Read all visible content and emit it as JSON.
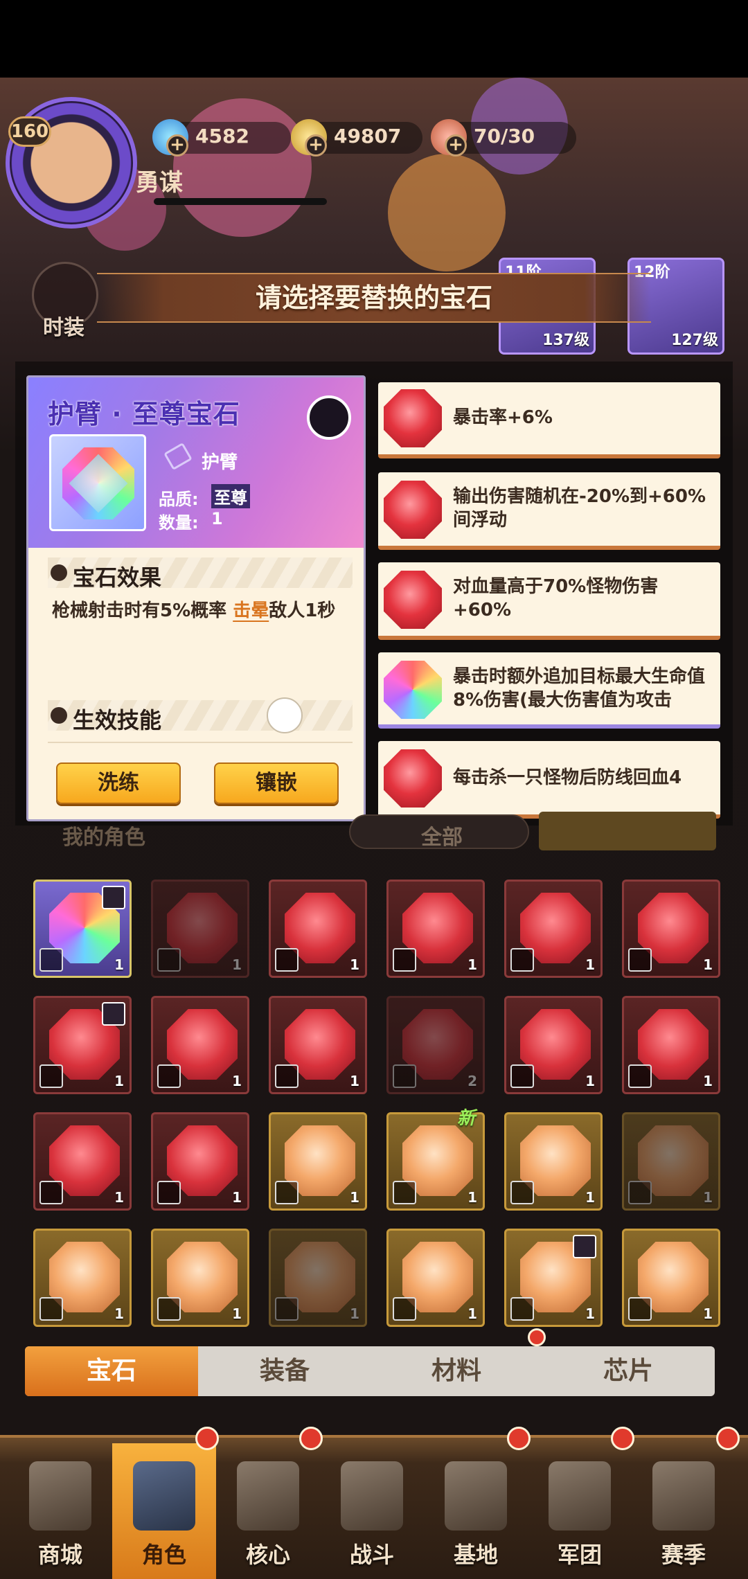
{
  "header": {
    "level": "160",
    "player_name": "勇谋",
    "resources": [
      {
        "icon": "gem-currency-icon",
        "value": "4582"
      },
      {
        "icon": "r-coin-icon",
        "value": "49807"
      },
      {
        "icon": "meat-stamina-icon",
        "value": "70/30"
      }
    ],
    "side_button_label": "时装",
    "mini_cards": [
      {
        "top": "11阶",
        "bottom": "137级"
      },
      {
        "top": "12阶",
        "bottom": "127级"
      }
    ]
  },
  "title": "请选择要替换的宝石",
  "detail": {
    "name": "护臂 · 至尊宝石",
    "slot": "护臂",
    "quality_label": "品质:",
    "quality_value": "至尊",
    "count_label": "数量:",
    "count_value": "1",
    "effect_heading": "宝石效果",
    "effect_text_before": "枪械射击时有5%概率 ",
    "effect_highlight": "击晕",
    "effect_text_after": "敌人1秒",
    "skill_heading": "生效技能",
    "skill_icon": "rifle-icon",
    "btn_refine": "洗练",
    "btn_inlay": "镶嵌"
  },
  "options": [
    {
      "text": "暴击率+6%",
      "gem": "red"
    },
    {
      "text": "输出伤害随机在-20%到+60%间浮动",
      "gem": "red"
    },
    {
      "text": "对血量高于70%怪物伤害+60%",
      "gem": "red"
    },
    {
      "text": "暴击时额外追加目标最大生命值8%伤害(最大伤害值为攻击",
      "gem": "rainbow"
    },
    {
      "text": "每击杀一只怪物后防线回血4",
      "gem": "red"
    }
  ],
  "filter": {
    "left_label": "我的角色",
    "mid_label": "全部"
  },
  "grid": [
    {
      "frame": "purple",
      "gem": "rainbow",
      "slot": "arm-guard-icon",
      "count": "1",
      "locked": true,
      "dim": false
    },
    {
      "frame": "red",
      "gem": "red",
      "slot": "helmet-icon",
      "count": "1",
      "locked": false,
      "dim": true
    },
    {
      "frame": "red",
      "gem": "red",
      "slot": "helmet-icon",
      "count": "1",
      "locked": false,
      "dim": false
    },
    {
      "frame": "red",
      "gem": "red",
      "slot": "helmet-icon",
      "count": "1",
      "locked": false,
      "dim": false
    },
    {
      "frame": "red",
      "gem": "red",
      "slot": "armor-icon",
      "count": "1",
      "locked": false,
      "dim": false
    },
    {
      "frame": "red",
      "gem": "red",
      "slot": "armor-icon",
      "count": "1",
      "locked": false,
      "dim": false
    },
    {
      "frame": "red",
      "gem": "red",
      "slot": "armor-icon",
      "count": "1",
      "locked": true,
      "dim": false
    },
    {
      "frame": "red",
      "gem": "red",
      "slot": "boots-icon",
      "count": "1",
      "locked": false,
      "dim": false
    },
    {
      "frame": "red",
      "gem": "red",
      "slot": "pants-icon",
      "count": "1",
      "locked": false,
      "dim": false
    },
    {
      "frame": "red",
      "gem": "red",
      "slot": "pants-icon",
      "count": "2",
      "locked": false,
      "dim": true
    },
    {
      "frame": "red",
      "gem": "red",
      "slot": "glove-icon",
      "count": "1",
      "locked": false,
      "dim": false
    },
    {
      "frame": "red",
      "gem": "red",
      "slot": "glove-icon",
      "count": "1",
      "locked": false,
      "dim": false
    },
    {
      "frame": "red",
      "gem": "red",
      "slot": "glove-icon",
      "count": "1",
      "locked": false,
      "dim": false
    },
    {
      "frame": "red",
      "gem": "red",
      "slot": "glove-icon",
      "count": "1",
      "locked": false,
      "dim": false
    },
    {
      "frame": "gold",
      "gem": "orange",
      "slot": "helmet-icon",
      "count": "1",
      "locked": false,
      "dim": false
    },
    {
      "frame": "gold",
      "gem": "orange",
      "slot": "armor-icon",
      "count": "1",
      "locked": false,
      "dim": false
    },
    {
      "frame": "gold",
      "gem": "orange",
      "slot": "armor-icon",
      "count": "1",
      "locked": false,
      "dim": false
    },
    {
      "frame": "gold",
      "gem": "orange",
      "slot": "armor-icon",
      "count": "1",
      "locked": false,
      "dim": true
    },
    {
      "frame": "gold",
      "gem": "orange",
      "slot": "arm-guard-icon",
      "count": "1",
      "locked": false,
      "dim": false
    },
    {
      "frame": "gold",
      "gem": "orange",
      "slot": "arm-guard-icon",
      "count": "1",
      "locked": false,
      "dim": false
    },
    {
      "frame": "gold",
      "gem": "orange",
      "slot": "arm-guard-icon",
      "count": "1",
      "locked": false,
      "dim": true
    },
    {
      "frame": "gold",
      "gem": "orange",
      "slot": "arm-guard-icon",
      "count": "1",
      "locked": false,
      "dim": false
    },
    {
      "frame": "gold",
      "gem": "orange",
      "slot": "pants-icon",
      "count": "1",
      "locked": true,
      "dim": false
    },
    {
      "frame": "gold",
      "gem": "orange",
      "slot": "glove-icon",
      "count": "1",
      "locked": false,
      "dim": false
    }
  ],
  "new_badge": "新",
  "tabs": [
    "宝石",
    "装备",
    "材料",
    "芯片"
  ],
  "nav": [
    {
      "label": "商城",
      "icon": "shop-icon"
    },
    {
      "label": "角色",
      "icon": "character-icon"
    },
    {
      "label": "核心",
      "icon": "core-icon"
    },
    {
      "label": "战斗",
      "icon": "battle-icon"
    },
    {
      "label": "基地",
      "icon": "base-icon"
    },
    {
      "label": "军团",
      "icon": "legion-icon"
    },
    {
      "label": "赛季",
      "icon": "season-icon"
    }
  ]
}
